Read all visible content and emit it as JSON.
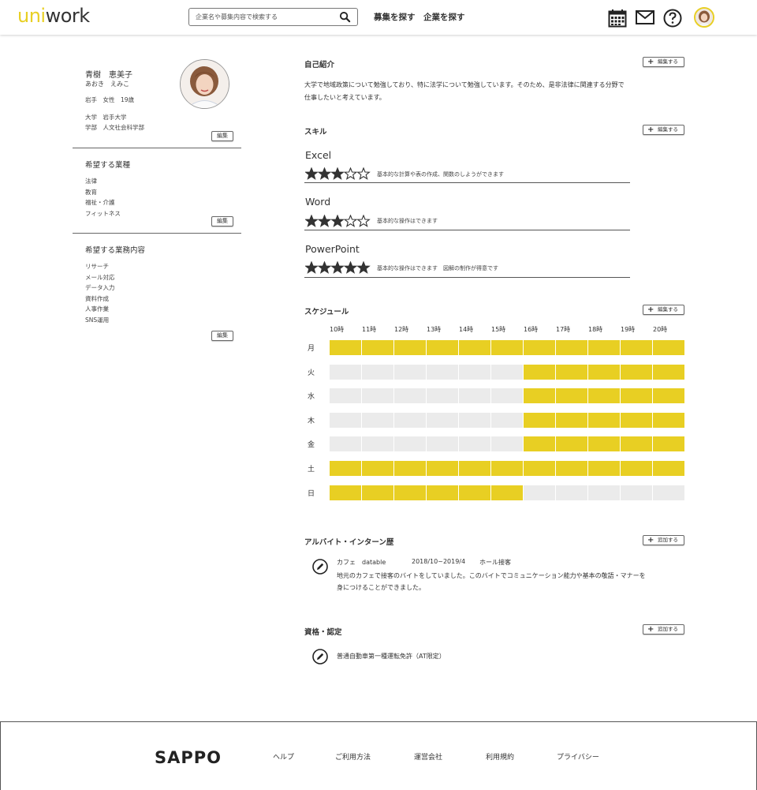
{
  "header": {
    "logo_uni": "uni",
    "logo_work": "work",
    "search_placeholder": "企業名や募集内容で検索する",
    "nav": [
      "募集を探す",
      "企業を探す"
    ],
    "icons": [
      "calendar-icon",
      "mail-icon",
      "help-icon"
    ]
  },
  "profile": {
    "name": "青樹　恵美子",
    "kana": "あおき　えみこ",
    "demographics": "岩手　女性　19歳",
    "university": "大学　岩手大学",
    "faculty": "学部　人文社会科学部",
    "edit_label": "編集"
  },
  "desired_industry": {
    "title": "希望する業種",
    "items": [
      "法律",
      "教育",
      "福祉・介護",
      "フィットネス"
    ],
    "edit_label": "編集"
  },
  "desired_work": {
    "title": "希望する業務内容",
    "items": [
      "リサーチ",
      "メール対応",
      "データ入力",
      "資料作成",
      "人事作業",
      "SNS運用"
    ],
    "edit_label": "編集"
  },
  "self_intro": {
    "title": "自己紹介",
    "button": "編集する",
    "line1": "大学で地域政策について勉強しており、特に法学について勉強しています。そのため、是非法律に関連する分野で",
    "line2": "仕事したいと考えています。"
  },
  "skills": {
    "title": "スキル",
    "button": "編集する",
    "items": [
      {
        "name": "Excel",
        "rating": 3,
        "max": 5,
        "desc": "基本的な計算や表の作成、関数のしようができます"
      },
      {
        "name": "Word",
        "rating": 3,
        "max": 5,
        "desc": "基本的な操作はできます"
      },
      {
        "name": "PowerPoint",
        "rating": 5,
        "max": 5,
        "desc": "基本的な操作はできます　図解の制作が得意です"
      }
    ]
  },
  "schedule": {
    "title": "スケジュール",
    "button": "編集する",
    "hours": [
      "10時",
      "11時",
      "12時",
      "13時",
      "14時",
      "15時",
      "16時",
      "17時",
      "18時",
      "19時",
      "20時"
    ],
    "days": [
      {
        "label": "月",
        "available": [
          1,
          1,
          1,
          1,
          1,
          1,
          1,
          1,
          1,
          1,
          1
        ]
      },
      {
        "label": "火",
        "available": [
          0,
          0,
          0,
          0,
          0,
          0,
          1,
          1,
          1,
          1,
          1
        ]
      },
      {
        "label": "水",
        "available": [
          0,
          0,
          0,
          0,
          0,
          0,
          1,
          1,
          1,
          1,
          1
        ]
      },
      {
        "label": "木",
        "available": [
          0,
          0,
          0,
          0,
          0,
          0,
          1,
          1,
          1,
          1,
          1
        ]
      },
      {
        "label": "金",
        "available": [
          0,
          0,
          0,
          0,
          0,
          0,
          1,
          1,
          1,
          1,
          1
        ]
      },
      {
        "label": "土",
        "available": [
          1,
          1,
          1,
          1,
          1,
          1,
          1,
          1,
          1,
          1,
          1
        ]
      },
      {
        "label": "日",
        "available": [
          1,
          1,
          1,
          1,
          1,
          1,
          0,
          0,
          0,
          0,
          0
        ]
      }
    ],
    "colors": {
      "available": "#e8cf23",
      "unavailable": "#ebebeb"
    }
  },
  "work_history": {
    "title": "アルバイト・インターン歴",
    "button": "追加する",
    "entry": {
      "company": "カフェ　datable",
      "period": "2018/10~2019/4",
      "role": "ホール接客",
      "desc1": "地元のカフェで接客のバイトをしていました。このバイトでコミュニケーション能力や基本の敬語・マナーを",
      "desc2": "身につけることができました。"
    }
  },
  "certifications": {
    "title": "資格・認定",
    "button": "追加する",
    "items": [
      "普通自動車第一種運転免許（AT限定）"
    ]
  },
  "footer": {
    "logo": "SAPPO",
    "links": [
      "ヘルプ",
      "ご利用方法",
      "運営会社",
      "利用規約",
      "プライバシー"
    ]
  }
}
